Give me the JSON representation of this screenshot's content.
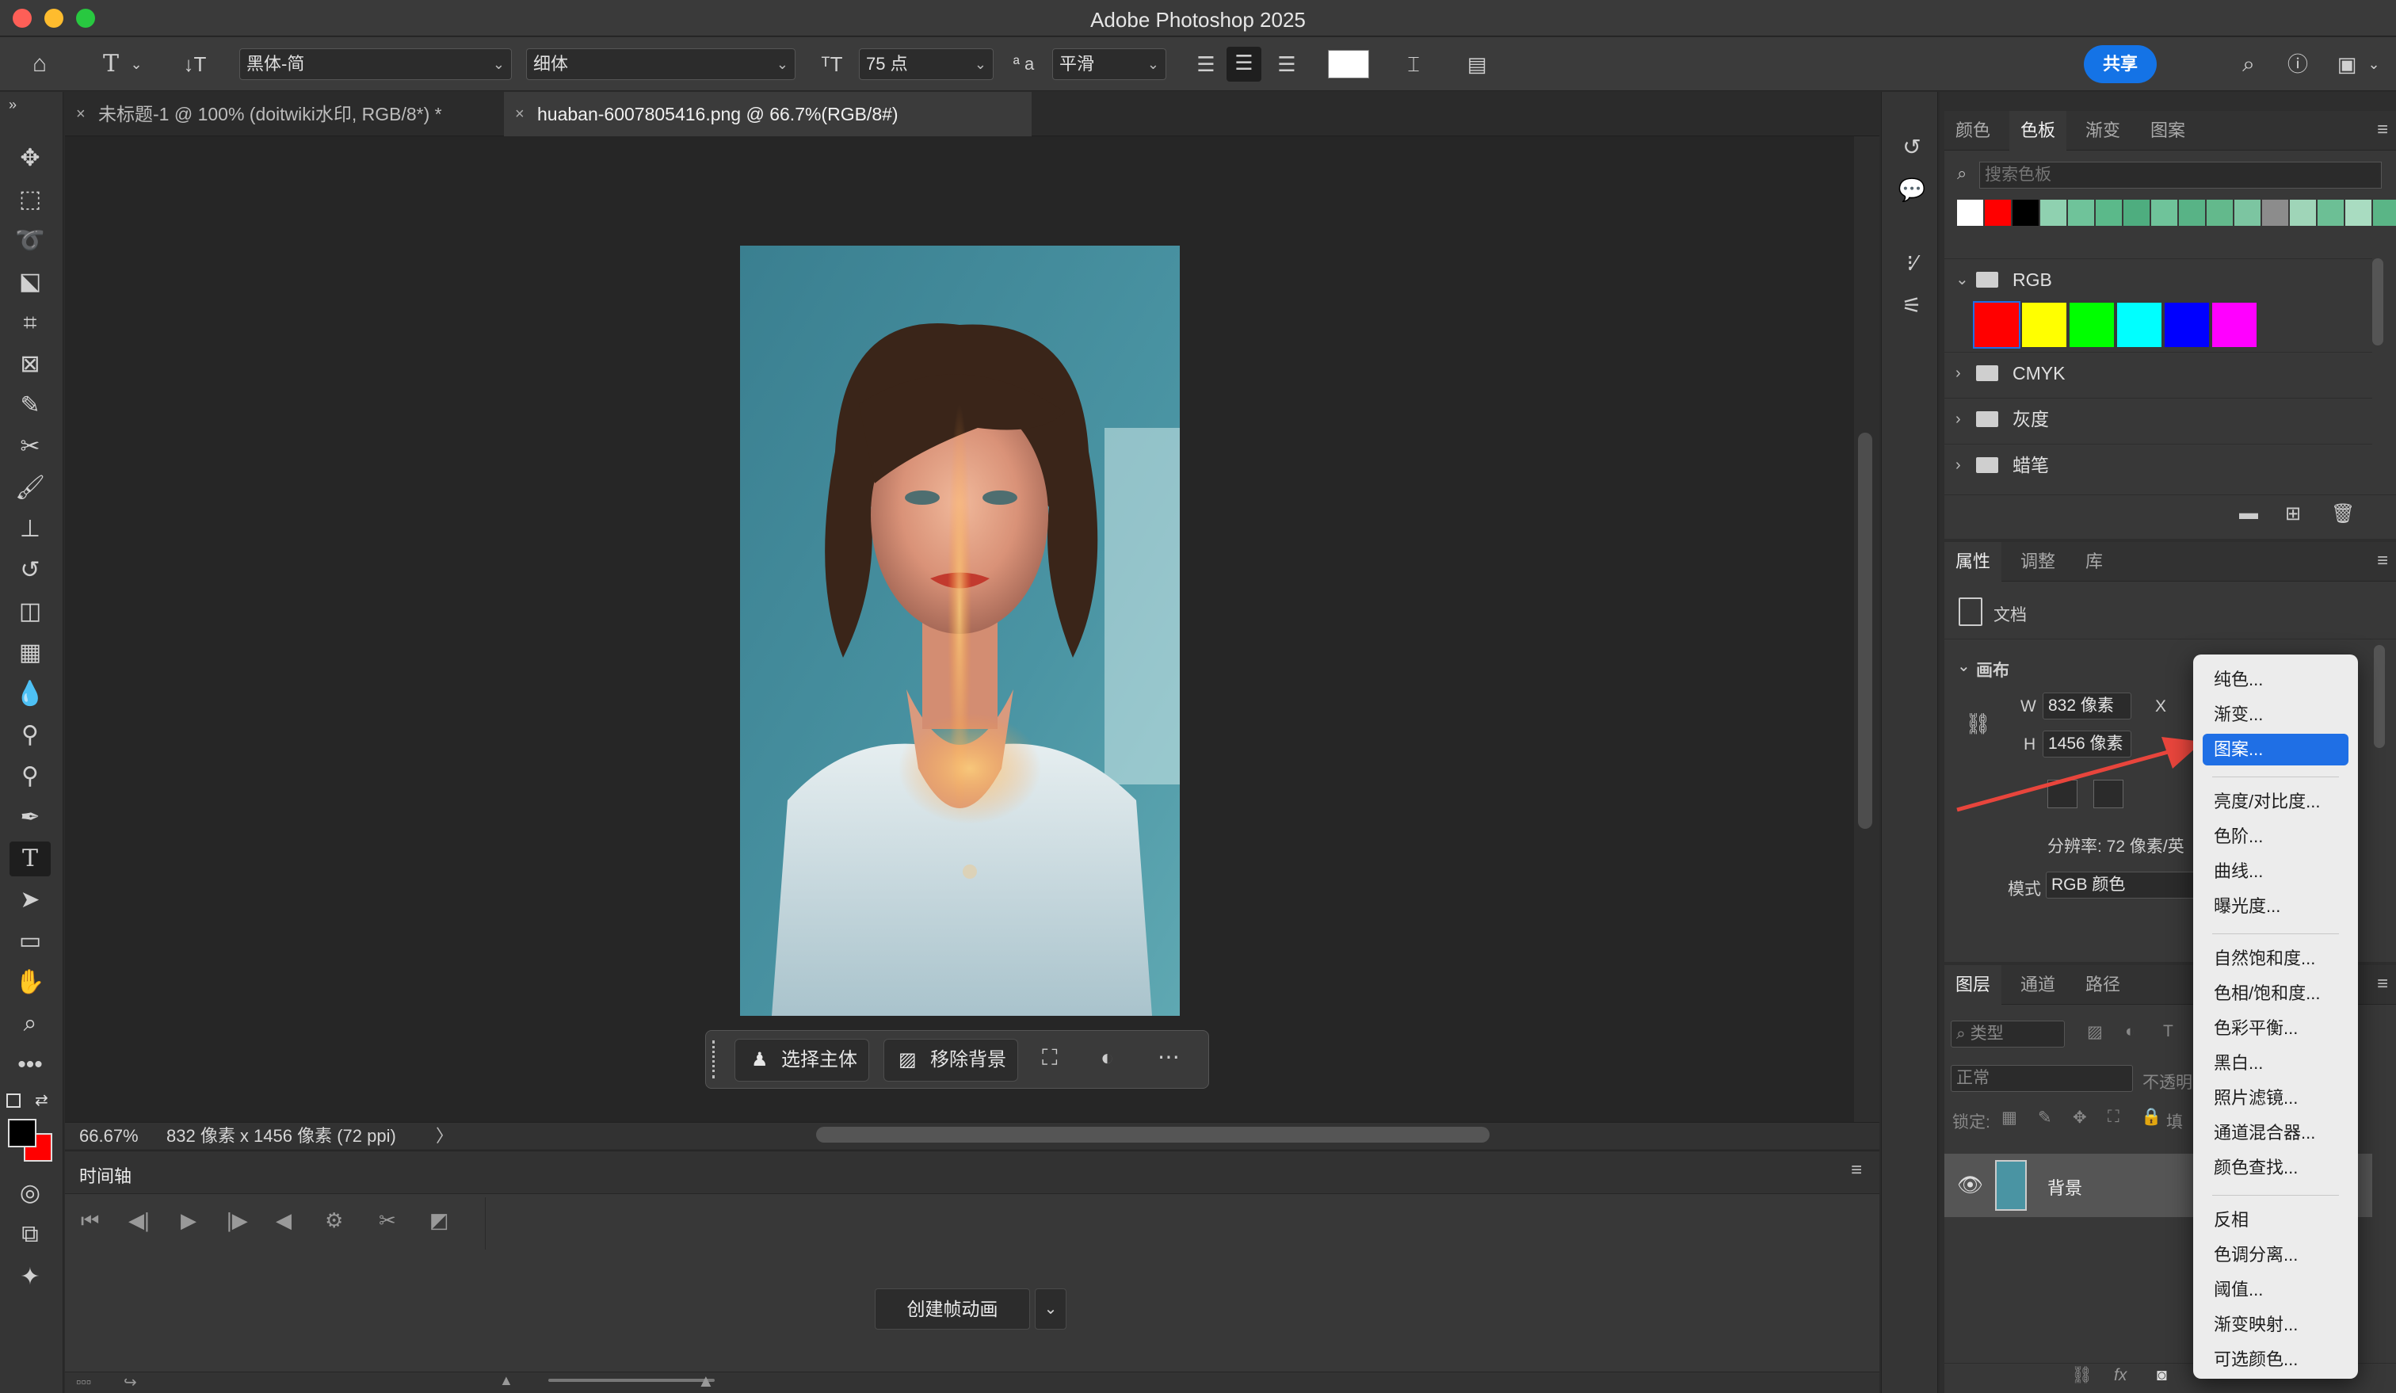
{
  "app": {
    "title": "Adobe Photoshop 2025",
    "traffic_colors": [
      "#fe5f57",
      "#febc2e",
      "#28c840"
    ]
  },
  "options_bar": {
    "font_family": "黑体-简",
    "font_style": "细体",
    "font_size": "75 点",
    "aa_label": "ª a",
    "antialias": "平滑",
    "share_label": "共享"
  },
  "tabs": [
    {
      "label": "未标题-1 @ 100% (doitwiki水印, RGB/8*) *",
      "active": false
    },
    {
      "label": "huaban-6007805416.png @ 66.7%(RGB/8#)",
      "active": true
    }
  ],
  "context_bar": {
    "select_subject": "选择主体",
    "remove_bg": "移除背景"
  },
  "status": {
    "zoom": "66.67%",
    "doc_info": "832 像素 x 1456 像素 (72 ppi)"
  },
  "timeline": {
    "title": "时间轴",
    "create_button": "创建帧动画"
  },
  "swatches_panel": {
    "tabs": [
      "颜色",
      "色板",
      "渐变",
      "图案"
    ],
    "search_placeholder": "搜索色板",
    "recent_colors": [
      "#ffffff",
      "#ff0000",
      "#000000",
      "#8fd1b0",
      "#6fc39a",
      "#5bb98a",
      "#4ead7f",
      "#6fc39a",
      "#58b386",
      "#63b98c",
      "#7cc5a1",
      "#8c8c8c",
      "#9fd5b8",
      "#6cbf95",
      "#a9dcc1",
      "#5ab586",
      "#48a676"
    ],
    "groups": [
      {
        "name": "RGB",
        "expanded": true
      },
      {
        "name": "CMYK",
        "expanded": false
      },
      {
        "name": "灰度",
        "expanded": false
      },
      {
        "name": "蜡笔",
        "expanded": false
      }
    ],
    "rgb_colors": [
      "#ff0000",
      "#ffff00",
      "#00ff00",
      "#00ffff",
      "#0000ff",
      "#ff00ff"
    ]
  },
  "properties_panel": {
    "tabs": [
      "属性",
      "调整",
      "库"
    ],
    "doc_label": "文档",
    "canvas_label": "画布",
    "width_label": "W",
    "width_value": "832 像素",
    "height_label": "H",
    "height_value": "1456 像素",
    "x_label": "X",
    "resolution": "分辨率: 72 像素/英",
    "mode_label": "模式",
    "mode_value": "RGB 颜色"
  },
  "layers_panel": {
    "tabs": [
      "图层",
      "通道",
      "路径"
    ],
    "filter_placeholder": "类型",
    "blend_mode": "正常",
    "opacity_label": "不透明",
    "lock_label": "锁定:",
    "fill_label": "填",
    "layer_name": "背景"
  },
  "adjustment_menu": {
    "items": [
      {
        "label": "纯色...",
        "group": 1
      },
      {
        "label": "渐变...",
        "group": 1
      },
      {
        "label": "图案...",
        "group": 1,
        "selected": true
      },
      {
        "label": "亮度/对比度...",
        "group": 2
      },
      {
        "label": "色阶...",
        "group": 2
      },
      {
        "label": "曲线...",
        "group": 2
      },
      {
        "label": "曝光度...",
        "group": 2
      },
      {
        "label": "自然饱和度...",
        "group": 3
      },
      {
        "label": "色相/饱和度...",
        "group": 3
      },
      {
        "label": "色彩平衡...",
        "group": 3
      },
      {
        "label": "黑白...",
        "group": 3
      },
      {
        "label": "照片滤镜...",
        "group": 3
      },
      {
        "label": "通道混合器...",
        "group": 3
      },
      {
        "label": "颜色查找...",
        "group": 3
      },
      {
        "label": "反相",
        "group": 4
      },
      {
        "label": "色调分离...",
        "group": 4
      },
      {
        "label": "阈值...",
        "group": 4
      },
      {
        "label": "渐变映射...",
        "group": 4
      },
      {
        "label": "可选颜色...",
        "group": 4
      }
    ]
  },
  "colors": {
    "accent": "#1473e6",
    "menu_selected": "#1f6fe5",
    "arrow": "#e8453c",
    "foreground": "#000000",
    "background": "#ff0000"
  }
}
